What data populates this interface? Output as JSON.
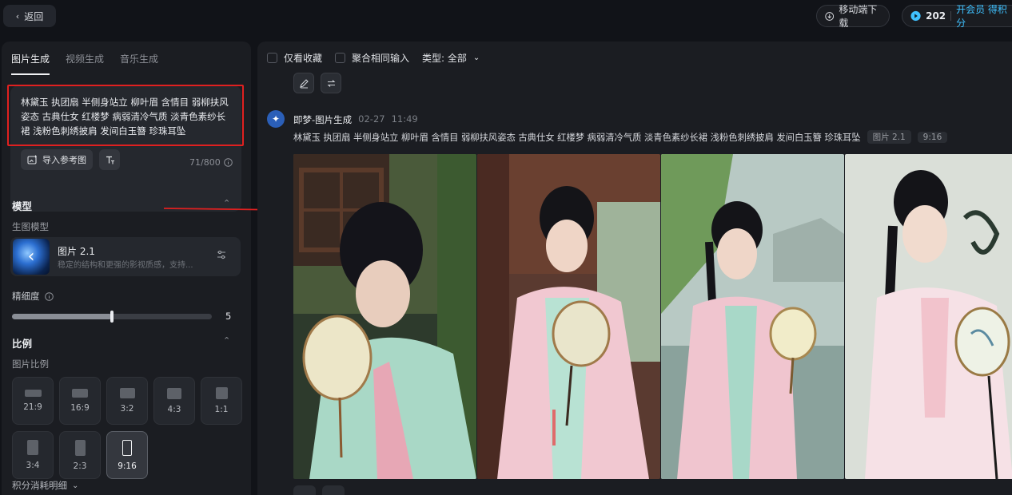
{
  "topbar": {
    "back_label": "返回",
    "download_label": "移动端下载",
    "credit_count": "202",
    "member_link": "开会员 得积分"
  },
  "left_panel": {
    "tabs": [
      {
        "label": "图片生成",
        "active": true
      },
      {
        "label": "视频生成",
        "active": false
      },
      {
        "label": "音乐生成",
        "active": false
      }
    ],
    "prompt": {
      "text": "林黛玉 执团扇 半侧身站立 柳叶眉 含情目 弱柳扶风姿态 古典仕女 红楼梦 病弱清冷气质 淡青色素纱长裙 浅粉色刺绣披肩 发间白玉簪 珍珠耳坠",
      "import_ref_label": "导入参考图",
      "char_count": "71/800"
    },
    "model_section": {
      "title": "模型",
      "sub_label": "生图模型",
      "model_name": "图片 2.1",
      "model_desc": "稳定的结构和更强的影视质感，支持..."
    },
    "detail": {
      "label": "精细度",
      "value": "5",
      "fraction": 0.5
    },
    "ratio_section": {
      "title": "比例",
      "sub_label": "图片比例",
      "options": [
        {
          "label": "21:9",
          "active": false
        },
        {
          "label": "16:9",
          "active": false
        },
        {
          "label": "3:2",
          "active": false
        },
        {
          "label": "4:3",
          "active": false
        },
        {
          "label": "1:1",
          "active": false
        },
        {
          "label": "3:4",
          "active": false
        },
        {
          "label": "2:3",
          "active": false
        },
        {
          "label": "9:16",
          "active": true
        }
      ]
    },
    "credits_detail_label": "积分消耗明细"
  },
  "right_panel": {
    "filters": {
      "favorites_only": "仅看收藏",
      "merge_inputs": "聚合相同输入",
      "type_label": "类型: 全部"
    },
    "generation": {
      "name": "即梦-图片生成",
      "date": "02-27",
      "time": "11:49",
      "prompt": "林黛玉 执团扇 半侧身站立 柳叶眉 含情目 弱柳扶风姿态 古典仕女 红楼梦 病弱清冷气质 淡青色素纱长裙 浅粉色刺绣披肩 发间白玉簪 珍珠耳坠",
      "model_tag": "图片 2.1",
      "ratio_tag": "9:16"
    }
  },
  "colors": {
    "accent_blue": "#3fc1ff",
    "highlight_red": "#e02020",
    "panel_bg": "#1b1d22",
    "page_bg": "#111318"
  }
}
